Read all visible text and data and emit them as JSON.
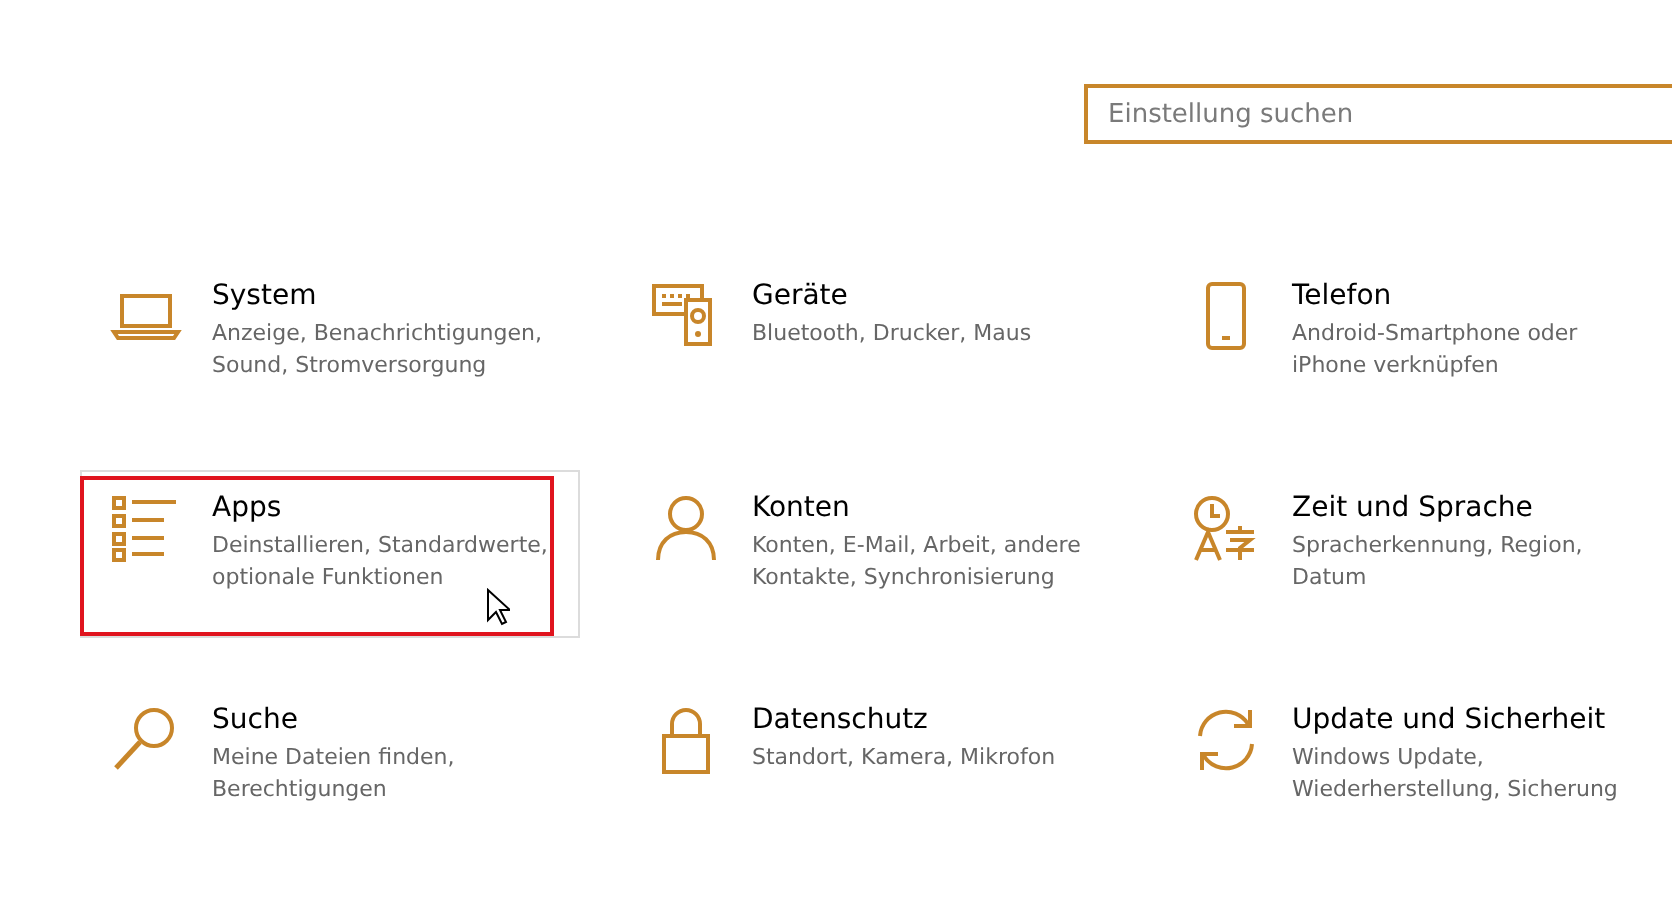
{
  "search": {
    "placeholder": "Einstellung suchen"
  },
  "categories": [
    {
      "kind": "laptop",
      "title": "System",
      "description": "Anzeige, Benachrichtigungen, Sound, Stromversorgung",
      "hovered": false,
      "highlighted": false
    },
    {
      "kind": "devices",
      "title": "Geräte",
      "description": "Bluetooth, Drucker, Maus",
      "hovered": false,
      "highlighted": false
    },
    {
      "kind": "phone",
      "title": "Telefon",
      "description": "Android-Smartphone oder iPhone verknüpfen",
      "hovered": false,
      "highlighted": false
    },
    {
      "kind": "list",
      "title": "Apps",
      "description": "Deinstallieren, Standardwerte, optionale Funktionen",
      "hovered": true,
      "highlighted": true
    },
    {
      "kind": "person",
      "title": "Konten",
      "description": "Konten, E-Mail, Arbeit, andere Kontakte, Synchronisierung",
      "hovered": false,
      "highlighted": false
    },
    {
      "kind": "language",
      "title": "Zeit und Sprache",
      "description": "Spracherkennung, Region, Datum",
      "hovered": false,
      "highlighted": false
    },
    {
      "kind": "search",
      "title": "Suche",
      "description": "Meine Dateien finden, Berechtigungen",
      "hovered": false,
      "highlighted": false
    },
    {
      "kind": "lock",
      "title": "Datenschutz",
      "description": "Standort, Kamera, Mikrofon",
      "hovered": false,
      "highlighted": false
    },
    {
      "kind": "sync",
      "title": "Update und Sicherheit",
      "description": "Windows Update, Wiederherstellung, Sicherung",
      "hovered": false,
      "highlighted": false
    }
  ]
}
